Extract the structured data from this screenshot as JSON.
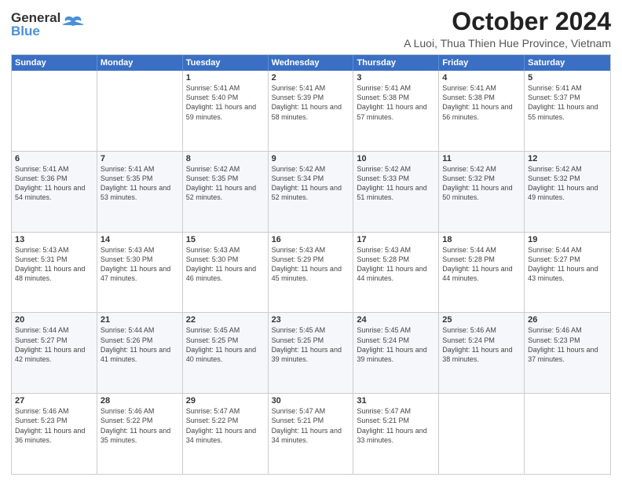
{
  "header": {
    "logo_general": "General",
    "logo_blue": "Blue",
    "month_title": "October 2024",
    "subtitle": "A Luoi, Thua Thien Hue Province, Vietnam"
  },
  "calendar": {
    "days": [
      "Sunday",
      "Monday",
      "Tuesday",
      "Wednesday",
      "Thursday",
      "Friday",
      "Saturday"
    ],
    "weeks": [
      [
        {
          "day": "",
          "info": ""
        },
        {
          "day": "",
          "info": ""
        },
        {
          "day": "1",
          "info": "Sunrise: 5:41 AM\nSunset: 5:40 PM\nDaylight: 11 hours and 59 minutes."
        },
        {
          "day": "2",
          "info": "Sunrise: 5:41 AM\nSunset: 5:39 PM\nDaylight: 11 hours and 58 minutes."
        },
        {
          "day": "3",
          "info": "Sunrise: 5:41 AM\nSunset: 5:38 PM\nDaylight: 11 hours and 57 minutes."
        },
        {
          "day": "4",
          "info": "Sunrise: 5:41 AM\nSunset: 5:38 PM\nDaylight: 11 hours and 56 minutes."
        },
        {
          "day": "5",
          "info": "Sunrise: 5:41 AM\nSunset: 5:37 PM\nDaylight: 11 hours and 55 minutes."
        }
      ],
      [
        {
          "day": "6",
          "info": "Sunrise: 5:41 AM\nSunset: 5:36 PM\nDaylight: 11 hours and 54 minutes."
        },
        {
          "day": "7",
          "info": "Sunrise: 5:41 AM\nSunset: 5:35 PM\nDaylight: 11 hours and 53 minutes."
        },
        {
          "day": "8",
          "info": "Sunrise: 5:42 AM\nSunset: 5:35 PM\nDaylight: 11 hours and 52 minutes."
        },
        {
          "day": "9",
          "info": "Sunrise: 5:42 AM\nSunset: 5:34 PM\nDaylight: 11 hours and 52 minutes."
        },
        {
          "day": "10",
          "info": "Sunrise: 5:42 AM\nSunset: 5:33 PM\nDaylight: 11 hours and 51 minutes."
        },
        {
          "day": "11",
          "info": "Sunrise: 5:42 AM\nSunset: 5:32 PM\nDaylight: 11 hours and 50 minutes."
        },
        {
          "day": "12",
          "info": "Sunrise: 5:42 AM\nSunset: 5:32 PM\nDaylight: 11 hours and 49 minutes."
        }
      ],
      [
        {
          "day": "13",
          "info": "Sunrise: 5:43 AM\nSunset: 5:31 PM\nDaylight: 11 hours and 48 minutes."
        },
        {
          "day": "14",
          "info": "Sunrise: 5:43 AM\nSunset: 5:30 PM\nDaylight: 11 hours and 47 minutes."
        },
        {
          "day": "15",
          "info": "Sunrise: 5:43 AM\nSunset: 5:30 PM\nDaylight: 11 hours and 46 minutes."
        },
        {
          "day": "16",
          "info": "Sunrise: 5:43 AM\nSunset: 5:29 PM\nDaylight: 11 hours and 45 minutes."
        },
        {
          "day": "17",
          "info": "Sunrise: 5:43 AM\nSunset: 5:28 PM\nDaylight: 11 hours and 44 minutes."
        },
        {
          "day": "18",
          "info": "Sunrise: 5:44 AM\nSunset: 5:28 PM\nDaylight: 11 hours and 44 minutes."
        },
        {
          "day": "19",
          "info": "Sunrise: 5:44 AM\nSunset: 5:27 PM\nDaylight: 11 hours and 43 minutes."
        }
      ],
      [
        {
          "day": "20",
          "info": "Sunrise: 5:44 AM\nSunset: 5:27 PM\nDaylight: 11 hours and 42 minutes."
        },
        {
          "day": "21",
          "info": "Sunrise: 5:44 AM\nSunset: 5:26 PM\nDaylight: 11 hours and 41 minutes."
        },
        {
          "day": "22",
          "info": "Sunrise: 5:45 AM\nSunset: 5:25 PM\nDaylight: 11 hours and 40 minutes."
        },
        {
          "day": "23",
          "info": "Sunrise: 5:45 AM\nSunset: 5:25 PM\nDaylight: 11 hours and 39 minutes."
        },
        {
          "day": "24",
          "info": "Sunrise: 5:45 AM\nSunset: 5:24 PM\nDaylight: 11 hours and 39 minutes."
        },
        {
          "day": "25",
          "info": "Sunrise: 5:46 AM\nSunset: 5:24 PM\nDaylight: 11 hours and 38 minutes."
        },
        {
          "day": "26",
          "info": "Sunrise: 5:46 AM\nSunset: 5:23 PM\nDaylight: 11 hours and 37 minutes."
        }
      ],
      [
        {
          "day": "27",
          "info": "Sunrise: 5:46 AM\nSunset: 5:23 PM\nDaylight: 11 hours and 36 minutes."
        },
        {
          "day": "28",
          "info": "Sunrise: 5:46 AM\nSunset: 5:22 PM\nDaylight: 11 hours and 35 minutes."
        },
        {
          "day": "29",
          "info": "Sunrise: 5:47 AM\nSunset: 5:22 PM\nDaylight: 11 hours and 34 minutes."
        },
        {
          "day": "30",
          "info": "Sunrise: 5:47 AM\nSunset: 5:21 PM\nDaylight: 11 hours and 34 minutes."
        },
        {
          "day": "31",
          "info": "Sunrise: 5:47 AM\nSunset: 5:21 PM\nDaylight: 11 hours and 33 minutes."
        },
        {
          "day": "",
          "info": ""
        },
        {
          "day": "",
          "info": ""
        }
      ]
    ]
  }
}
